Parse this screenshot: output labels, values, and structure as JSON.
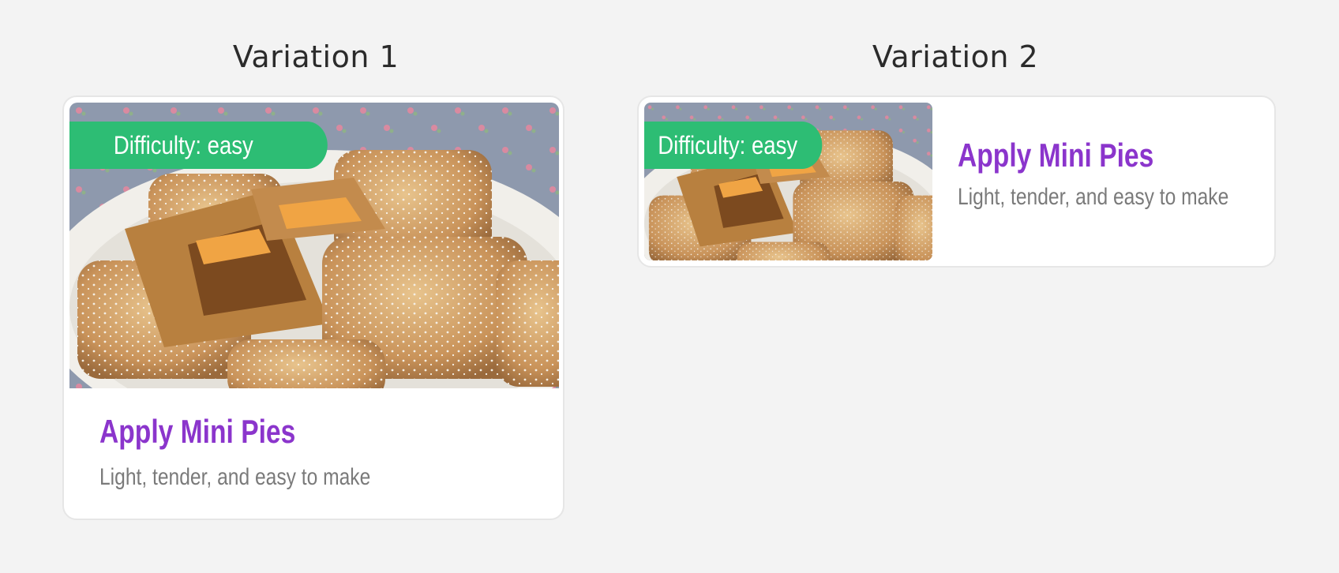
{
  "variations": [
    {
      "heading": "Variation 1",
      "card": {
        "badge": "Difficulty: easy",
        "title": "Apply Mini Pies",
        "subtitle": "Light, tender, and easy to make",
        "image": "mini-pies-photo"
      }
    },
    {
      "heading": "Variation 2",
      "card": {
        "badge": "Difficulty: easy",
        "title": "Apply Mini Pies",
        "subtitle": "Light, tender, and easy to make",
        "image": "mini-pies-photo"
      }
    }
  ],
  "colors": {
    "background": "#f3f3f3",
    "badge": "#2dbd74",
    "title": "#8b35cc",
    "subtitle": "#7a7a7a"
  }
}
